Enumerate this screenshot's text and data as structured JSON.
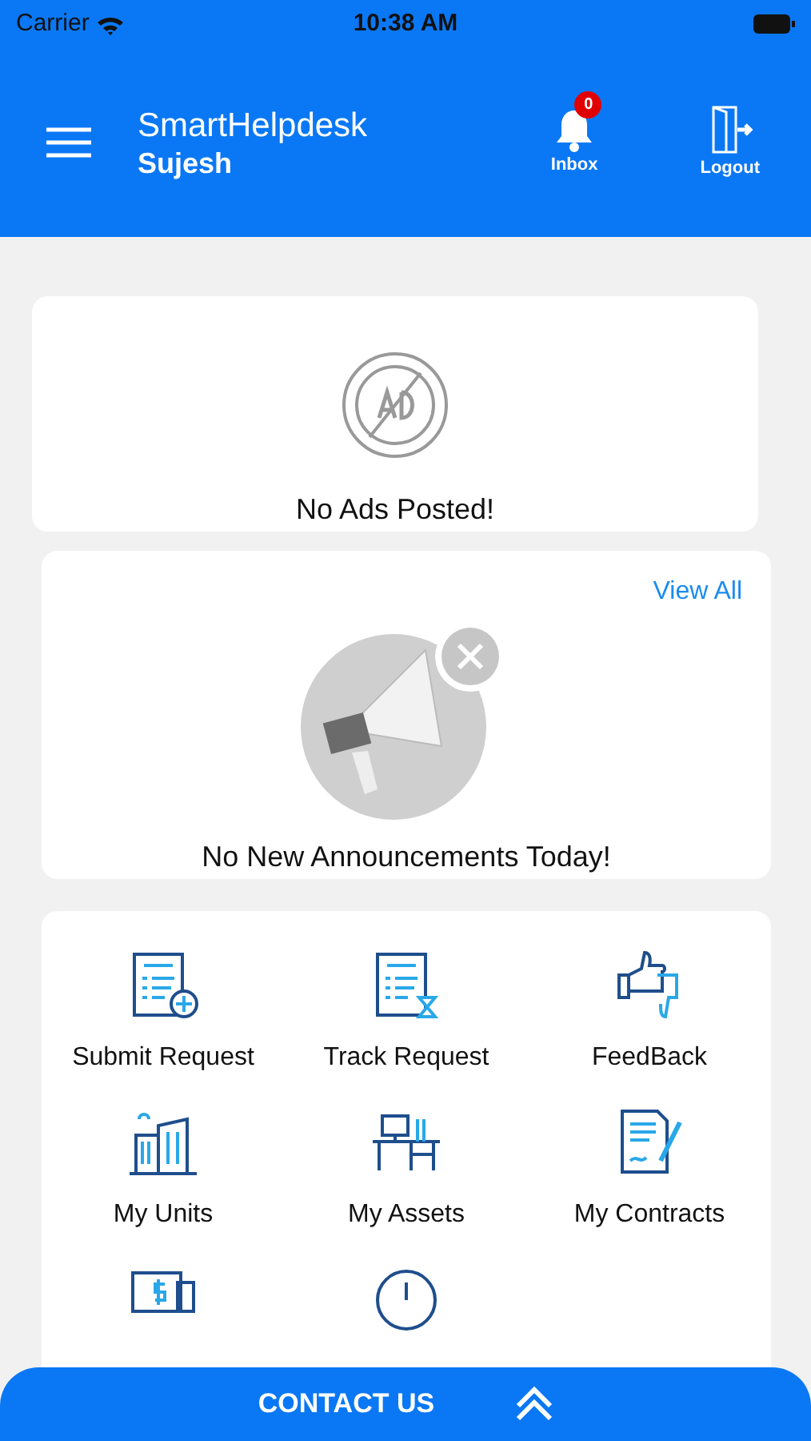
{
  "status_bar": {
    "carrier": "Carrier",
    "time": "10:38 AM"
  },
  "header": {
    "title": "SmartHelpdesk",
    "user": "Sujesh",
    "actions": [
      {
        "kind": "inbox",
        "label": "Inbox",
        "badge": "0"
      },
      {
        "kind": "logout",
        "label": "Logout"
      }
    ]
  },
  "ads": {
    "message": "No Ads Posted!"
  },
  "announcements": {
    "link": "View All",
    "message": "No New Announcements Today!"
  },
  "menu": [
    {
      "kind": "submit",
      "label": "Submit Request"
    },
    {
      "kind": "track",
      "label": "Track Request"
    },
    {
      "kind": "feedback",
      "label": "FeedBack"
    },
    {
      "kind": "units",
      "label": "My Units"
    },
    {
      "kind": "assets",
      "label": "My Assets"
    },
    {
      "kind": "contracts",
      "label": "My Contracts"
    },
    {
      "kind": "payments"
    },
    {
      "kind": "clock"
    }
  ],
  "contact_bar": {
    "label": "CONTACT US"
  }
}
